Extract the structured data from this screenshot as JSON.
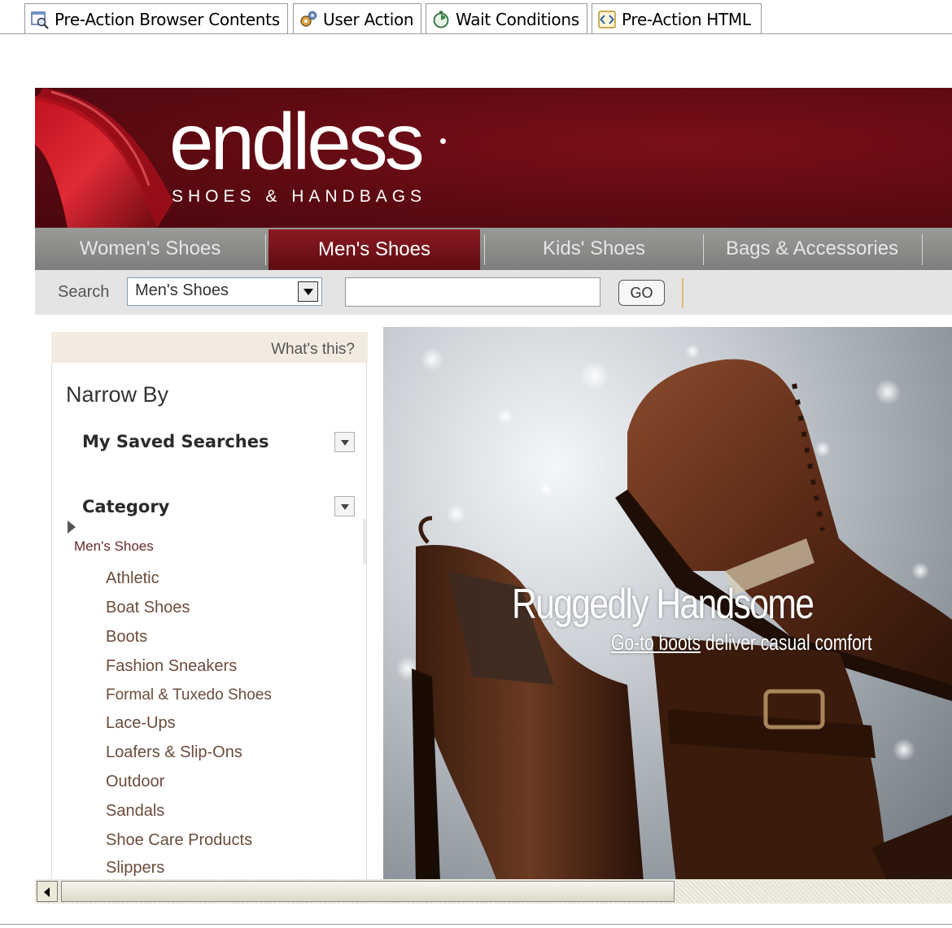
{
  "tabs": [
    {
      "label": "Pre-Action Browser Contents",
      "icon": "browser-magnifier-icon"
    },
    {
      "label": "User Action",
      "icon": "gears-icon"
    },
    {
      "label": "Wait Conditions",
      "icon": "stopwatch-icon"
    },
    {
      "label": "Pre-Action HTML",
      "icon": "html-code-icon"
    }
  ],
  "site": {
    "logo": "endless",
    "logo_sub": "SHOES & HANDBAGS",
    "nav": [
      "Women's Shoes",
      "Men's Shoes",
      "Kids' Shoes",
      "Bags & Accessories"
    ],
    "nav_active": "Men's Shoes"
  },
  "search": {
    "label": "Search",
    "selected": "Men's Shoes",
    "query": "",
    "go": "GO"
  },
  "sidebar": {
    "whats_this": "What's this?",
    "title": "Narrow By",
    "sections": [
      "My Saved Searches",
      "Category"
    ],
    "breadcrumb": "Men's Shoes",
    "categories": [
      "Athletic",
      "Boat Shoes",
      "Boots",
      "Fashion Sneakers",
      "Formal & Tuxedo Shoes",
      "Lace-Ups",
      "Loafers & Slip-Ons",
      "Outdoor",
      "Sandals",
      "Shoe Care Products",
      "Slippers"
    ]
  },
  "banner": {
    "title": "Ruggedly Handsome",
    "sub_link": "Go-to boots",
    "sub_rest": " deliver casual comfort"
  },
  "colors": {
    "brand_maroon": "#5e0a12",
    "nav_gray": "#8a8b88",
    "category_text": "#6b4c3b"
  }
}
